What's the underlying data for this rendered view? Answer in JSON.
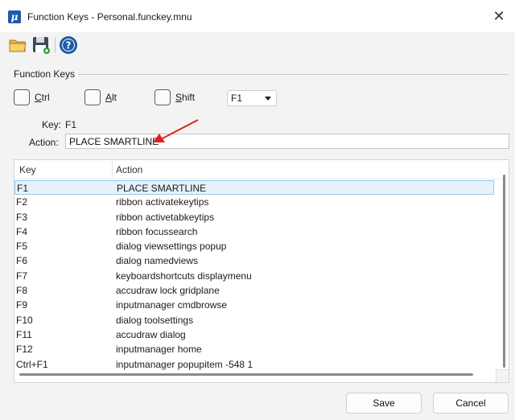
{
  "window": {
    "title": "Function Keys - Personal.funckey.mnu",
    "close_glyph": "✕"
  },
  "toolbar": {
    "icons": [
      "folder-open-icon",
      "save-icon",
      "help-icon"
    ]
  },
  "group": {
    "label": "Function Keys"
  },
  "modifiers": {
    "ctrl": "Ctrl",
    "alt": "Alt",
    "shift": "Shift"
  },
  "key_select": {
    "value": "F1"
  },
  "detail": {
    "key_label": "Key:",
    "key_value": "F1",
    "action_label": "Action:",
    "action_value": "PLACE SMARTLINE"
  },
  "table": {
    "headers": {
      "key": "Key",
      "action": "Action"
    },
    "selected_row": 0,
    "rows": [
      {
        "key": "F1",
        "action": "PLACE SMARTLINE"
      },
      {
        "key": "F2",
        "action": "ribbon activatekeytips"
      },
      {
        "key": "F3",
        "action": "ribbon activetabkeytips"
      },
      {
        "key": "F4",
        "action": "ribbon focussearch"
      },
      {
        "key": "F5",
        "action": "dialog viewsettings popup"
      },
      {
        "key": "F6",
        "action": "dialog namedviews"
      },
      {
        "key": "F7",
        "action": "keyboardshortcuts displaymenu"
      },
      {
        "key": "F8",
        "action": "accudraw lock gridplane"
      },
      {
        "key": "F9",
        "action": "inputmanager cmdbrowse"
      },
      {
        "key": "F10",
        "action": "dialog toolsettings"
      },
      {
        "key": "F11",
        "action": "accudraw dialog"
      },
      {
        "key": "F12",
        "action": "inputmanager home"
      },
      {
        "key": "Ctrl+F1",
        "action": "inputmanager popupitem -548 1"
      }
    ]
  },
  "buttons": {
    "save": "Save",
    "cancel": "Cancel"
  },
  "colors": {
    "accent": "#1e5aa8",
    "selection": "#e6f2fb",
    "annotation_arrow": "#e02020"
  }
}
